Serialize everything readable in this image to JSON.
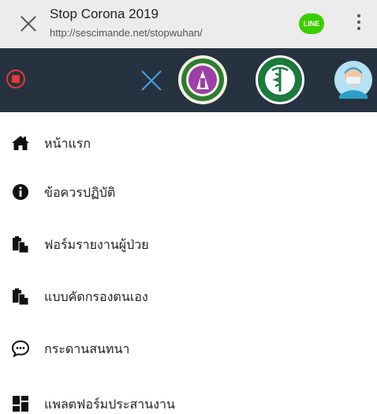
{
  "browser": {
    "title": "Stop Corona 2019",
    "url": "http://sescimande.net/stopwuhan/",
    "line_label": "LINE",
    "line_color": "#3ACE01"
  },
  "header": {
    "background": "#26323f",
    "stop_icon": "stop-record-icon",
    "close_icon": "close-icon",
    "logos": [
      "university-seal-logo",
      "ministry-of-public-health-logo"
    ],
    "avatar_icon": "doctor-avatar"
  },
  "menu": {
    "items": [
      {
        "label": "หน้าแรก",
        "icon": "home-icon"
      },
      {
        "label": "ข้อควรปฏิบัติ",
        "icon": "info-icon"
      },
      {
        "label": "ฟอร์มรายงานผู้ป่วย",
        "icon": "clipboard-icon"
      },
      {
        "label": "แบบคัดกรองตนเอง",
        "icon": "clipboard-icon"
      },
      {
        "label": "กระดานสนทนา",
        "icon": "chat-icon"
      },
      {
        "label": "แพลตฟอร์มประสานงาน",
        "icon": "dashboard-icon"
      }
    ]
  }
}
